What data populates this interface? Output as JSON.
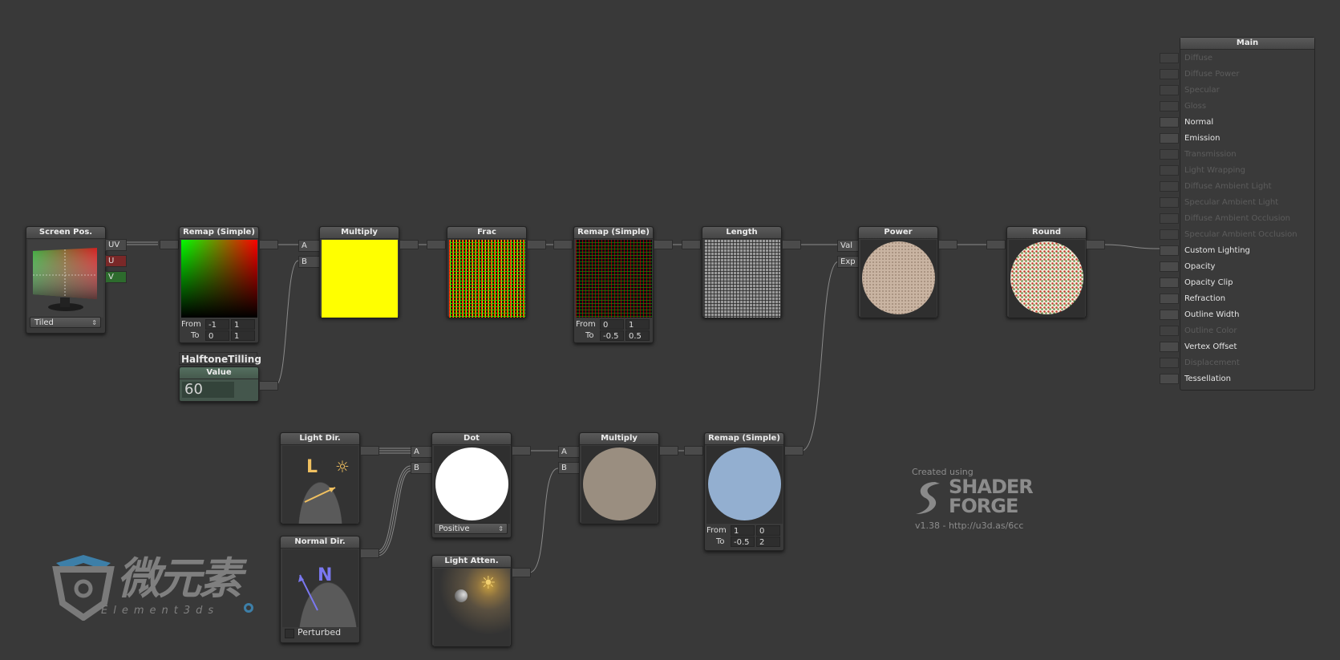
{
  "nodes": {
    "screen_pos": {
      "title": "Screen Pos.",
      "ports": [
        "UV",
        "U",
        "V"
      ],
      "mode": "Tiled"
    },
    "remap1": {
      "title": "Remap (Simple)",
      "from_label": "From",
      "to_label": "To",
      "from": [
        "-1",
        "1"
      ],
      "to": [
        "0",
        "1"
      ]
    },
    "halftone": {
      "name": "HalftoneTilling",
      "title": "Value",
      "value": "60"
    },
    "multiply1": {
      "title": "Multiply",
      "ports": [
        "A",
        "B"
      ]
    },
    "frac": {
      "title": "Frac"
    },
    "remap2": {
      "title": "Remap (Simple)",
      "from_label": "From",
      "to_label": "To",
      "from": [
        "0",
        "1"
      ],
      "to": [
        "-0.5",
        "0.5"
      ]
    },
    "length": {
      "title": "Length"
    },
    "power": {
      "title": "Power",
      "ports": [
        "Val",
        "Exp"
      ]
    },
    "round": {
      "title": "Round"
    },
    "light_dir": {
      "title": "Light Dir.",
      "glyph": "L"
    },
    "normal_dir": {
      "title": "Normal Dir.",
      "glyph": "N",
      "checkbox_label": "Perturbed"
    },
    "dot": {
      "title": "Dot",
      "ports": [
        "A",
        "B"
      ],
      "mode": "Positive"
    },
    "multiply2": {
      "title": "Multiply",
      "ports": [
        "A",
        "B"
      ]
    },
    "remap3": {
      "title": "Remap (Simple)",
      "from_label": "From",
      "to_label": "To",
      "from": [
        "1",
        "0"
      ],
      "to": [
        "-0.5",
        "2"
      ]
    },
    "light_atten": {
      "title": "Light Atten."
    }
  },
  "main": {
    "title": "Main",
    "inputs": [
      {
        "label": "Diffuse",
        "enabled": false
      },
      {
        "label": "Diffuse Power",
        "enabled": false
      },
      {
        "label": "Specular",
        "enabled": false
      },
      {
        "label": "Gloss",
        "enabled": false
      },
      {
        "label": "Normal",
        "enabled": true
      },
      {
        "label": "Emission",
        "enabled": true
      },
      {
        "label": "Transmission",
        "enabled": false
      },
      {
        "label": "Light Wrapping",
        "enabled": false
      },
      {
        "label": "Diffuse Ambient Light",
        "enabled": false
      },
      {
        "label": "Specular Ambient Light",
        "enabled": false
      },
      {
        "label": "Diffuse Ambient Occlusion",
        "enabled": false
      },
      {
        "label": "Specular Ambient Occlusion",
        "enabled": false
      },
      {
        "label": "Custom Lighting",
        "enabled": true
      },
      {
        "label": "Opacity",
        "enabled": true
      },
      {
        "label": "Opacity Clip",
        "enabled": true
      },
      {
        "label": "Refraction",
        "enabled": true
      },
      {
        "label": "Outline Width",
        "enabled": true
      },
      {
        "label": "Outline Color",
        "enabled": false
      },
      {
        "label": "Vertex Offset",
        "enabled": true
      },
      {
        "label": "Displacement",
        "enabled": false
      },
      {
        "label": "Tessellation",
        "enabled": true
      }
    ]
  },
  "watermark": {
    "chinese": "微元素",
    "latin": "Element3ds"
  },
  "credits": {
    "created": "Created using",
    "line1": "SHADER",
    "line2": "FORGE",
    "version": "v1.38 - http://u3d.as/6cc"
  },
  "colors": {
    "background": "#393939",
    "wire": "#8a8a8a"
  }
}
